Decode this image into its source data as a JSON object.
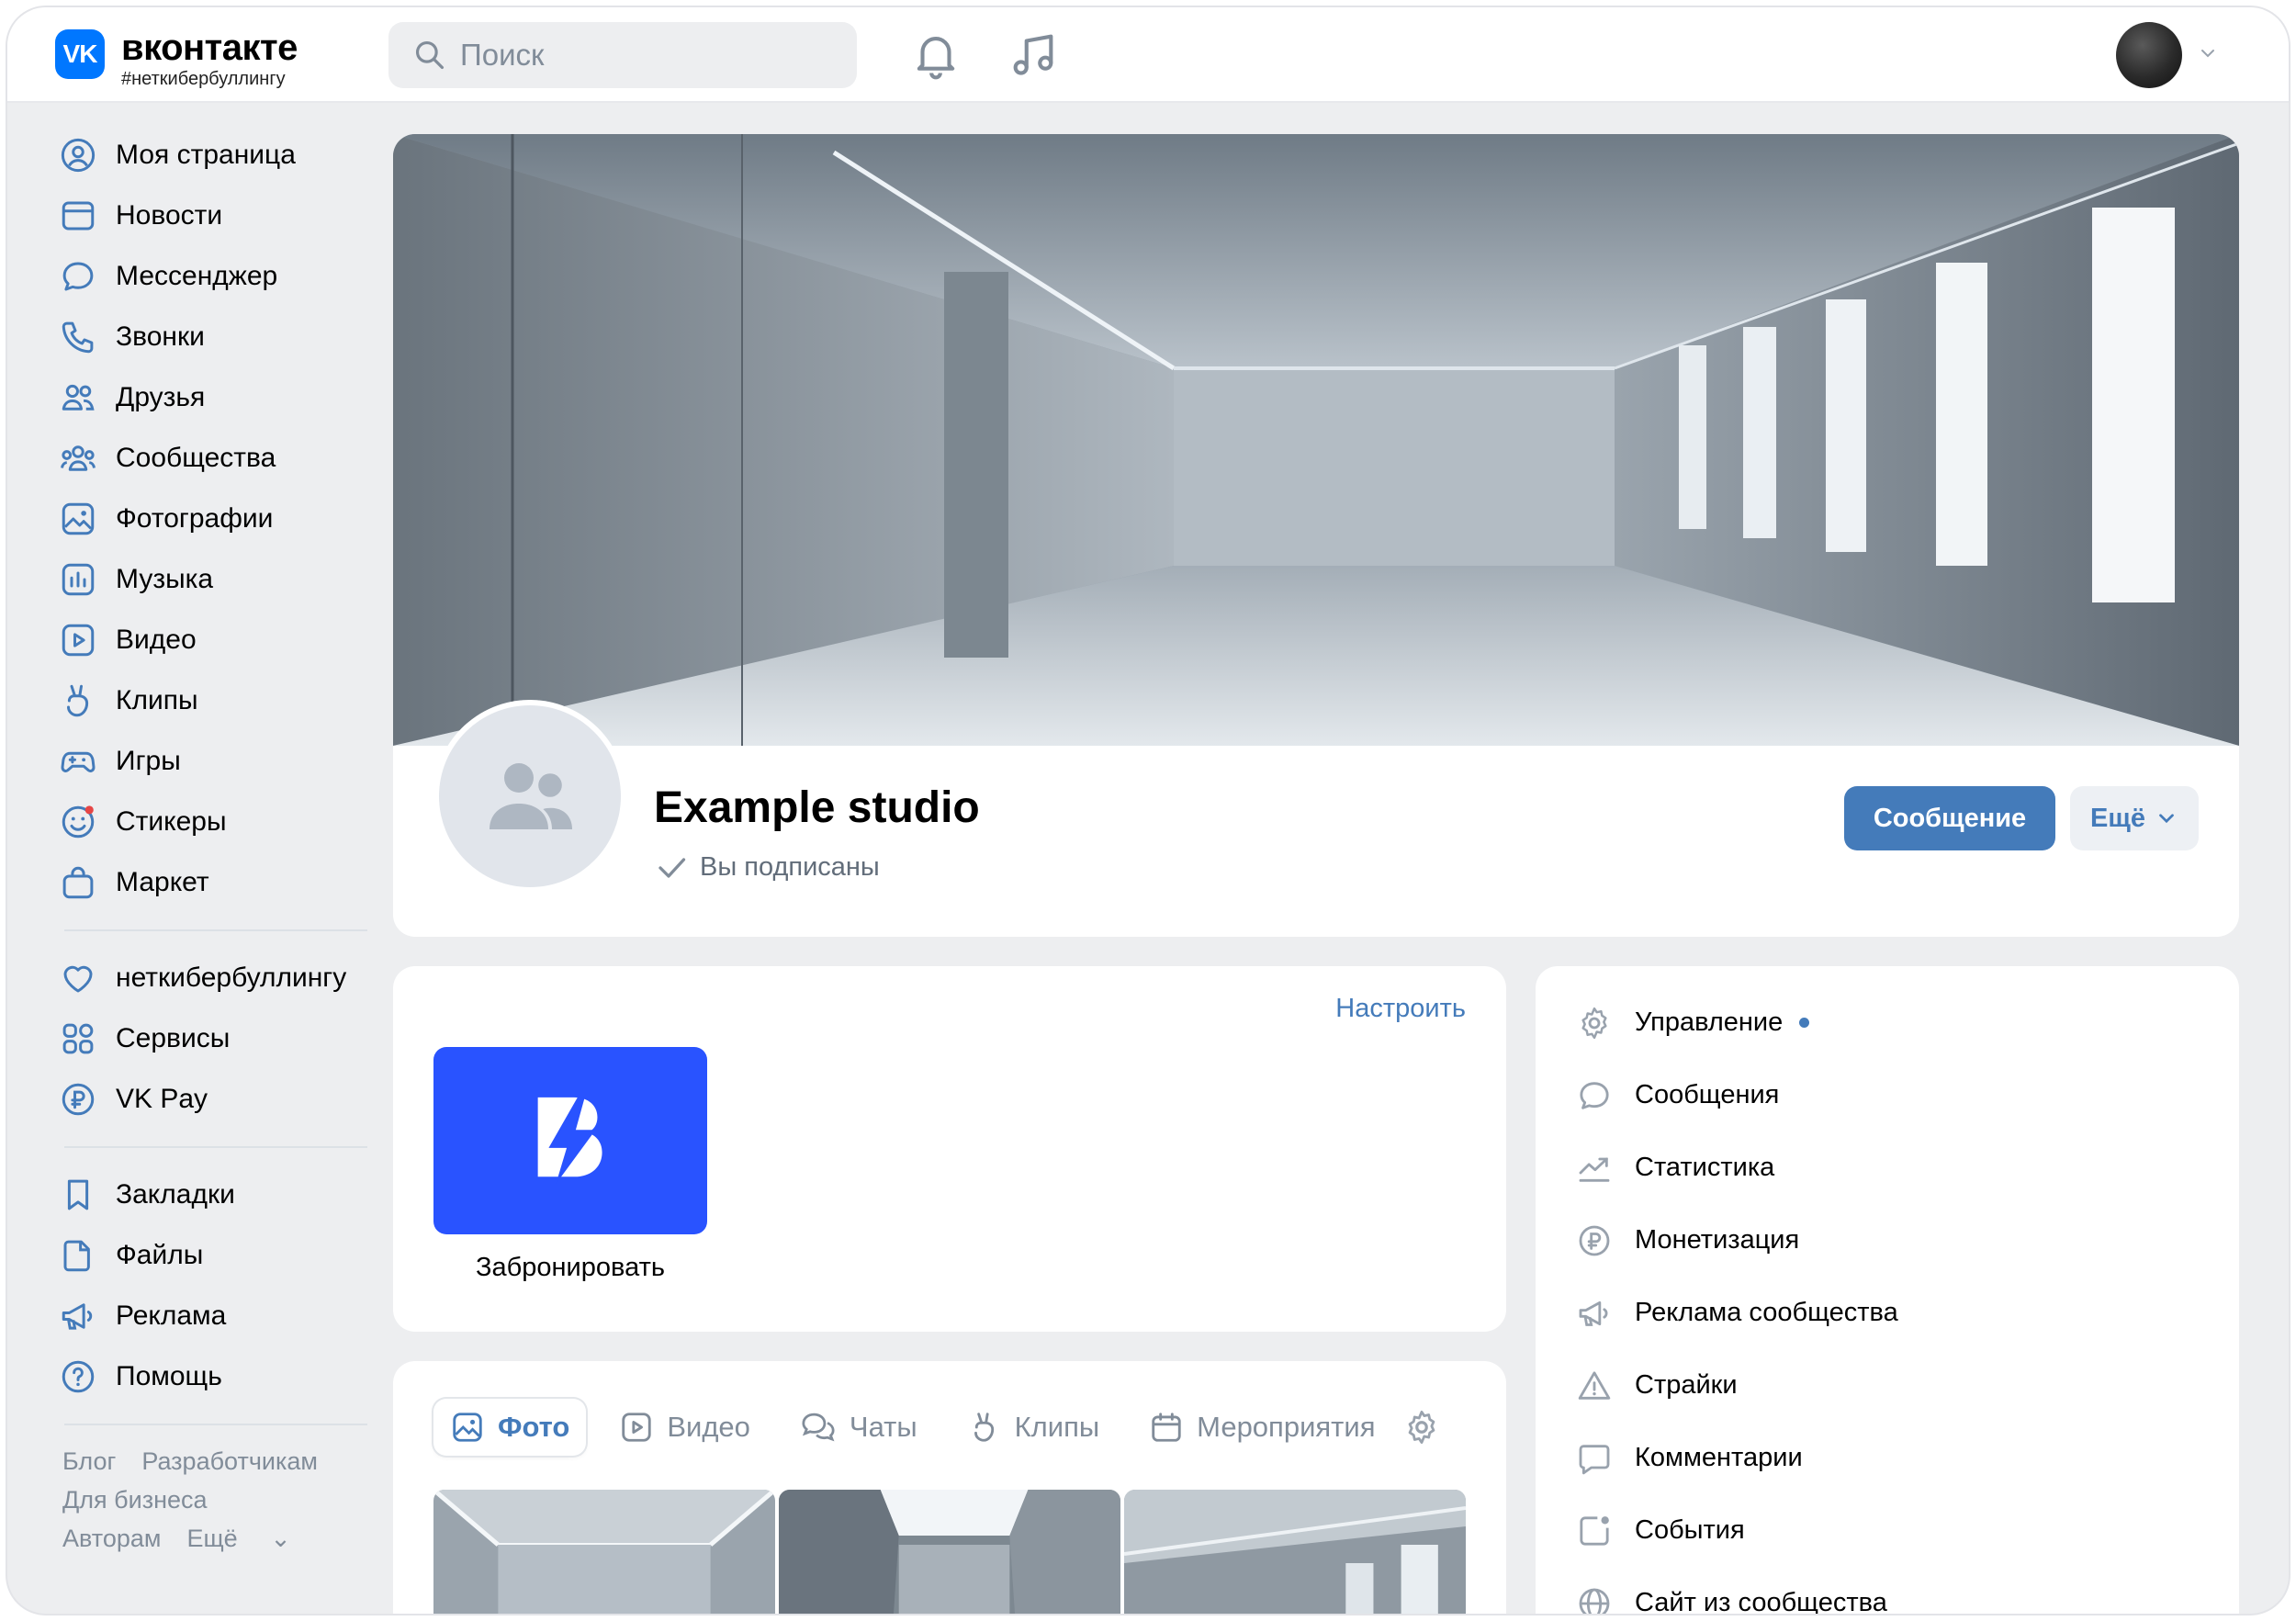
{
  "header": {
    "logo_mark": "VK",
    "logo_name": "вконтакте",
    "logo_tag": "#неткибербуллингу",
    "search_placeholder": "Поиск",
    "icons": [
      "bell-icon",
      "music-icon"
    ]
  },
  "sidebar": {
    "main": [
      {
        "label": "Моя страница",
        "icon": "user-circle-icon"
      },
      {
        "label": "Новости",
        "icon": "news-icon"
      },
      {
        "label": "Мессенджер",
        "icon": "message-icon"
      },
      {
        "label": "Звонки",
        "icon": "phone-icon"
      },
      {
        "label": "Друзья",
        "icon": "friends-icon"
      },
      {
        "label": "Сообщества",
        "icon": "communities-icon"
      },
      {
        "label": "Фотографии",
        "icon": "photo-icon"
      },
      {
        "label": "Музыка",
        "icon": "music-icon"
      },
      {
        "label": "Видео",
        "icon": "video-icon"
      },
      {
        "label": "Клипы",
        "icon": "clips-icon"
      },
      {
        "label": "Игры",
        "icon": "gamepad-icon"
      },
      {
        "label": "Стикеры",
        "icon": "sticker-icon"
      },
      {
        "label": "Маркет",
        "icon": "market-icon"
      }
    ],
    "extra": [
      {
        "label": "неткибербуллингу",
        "icon": "heart-icon"
      },
      {
        "label": "Сервисы",
        "icon": "services-icon"
      },
      {
        "label": "VK Pay",
        "icon": "ruble-icon"
      }
    ],
    "tools": [
      {
        "label": "Закладки",
        "icon": "bookmark-icon"
      },
      {
        "label": "Файлы",
        "icon": "file-icon"
      },
      {
        "label": "Реклама",
        "icon": "megaphone-icon"
      },
      {
        "label": "Помощь",
        "icon": "help-icon"
      }
    ],
    "footer": {
      "blog": "Блог",
      "developers": "Разработчикам",
      "business": "Для бизнеса",
      "authors": "Авторам",
      "more": "Ещё"
    }
  },
  "group": {
    "name": "Example studio",
    "status": "Вы подписаны",
    "message_button": "Сообщение",
    "more_button": "Ещё"
  },
  "apps": {
    "configure": "Настроить",
    "app_label": "Забронировать"
  },
  "content_tabs": [
    {
      "label": "Фото",
      "icon": "photo-icon",
      "active": true
    },
    {
      "label": "Видео",
      "icon": "video-icon",
      "active": false
    },
    {
      "label": "Чаты",
      "icon": "chats-icon",
      "active": false
    },
    {
      "label": "Клипы",
      "icon": "clips-icon",
      "active": false
    },
    {
      "label": "Мероприятия",
      "icon": "calendar-icon",
      "active": false
    }
  ],
  "admin_menu": [
    {
      "label": "Управление",
      "icon": "gear-icon",
      "dot": true
    },
    {
      "label": "Сообщения",
      "icon": "message-icon"
    },
    {
      "label": "Статистика",
      "icon": "chart-icon"
    },
    {
      "label": "Монетизация",
      "icon": "ruble-icon"
    },
    {
      "label": "Реклама сообщества",
      "icon": "megaphone-icon"
    },
    {
      "label": "Страйки",
      "icon": "warning-icon"
    },
    {
      "label": "Комментарии",
      "icon": "comment-icon"
    },
    {
      "label": "События",
      "icon": "event-icon"
    },
    {
      "label": "Сайт из сообщества",
      "icon": "globe-icon"
    }
  ],
  "colors": {
    "accent": "#447bba",
    "brand": "#0077ff",
    "app_tile": "#2953ff",
    "background": "#edeef0"
  }
}
